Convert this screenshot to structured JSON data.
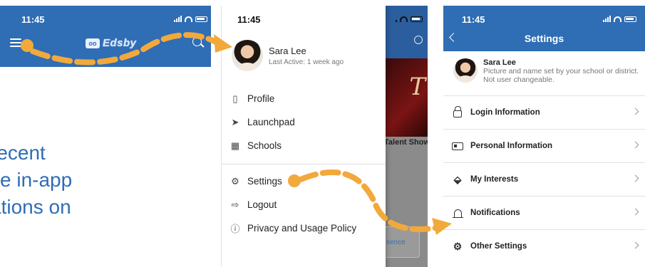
{
  "left_screen": {
    "time": "11:45",
    "logo_text": "Edsby",
    "caption_lines": [
      "recent",
      "ve in-app",
      "ations on"
    ]
  },
  "middle_screen": {
    "time": "11:45",
    "profile": {
      "name": "Sara Lee",
      "last_active": "Last Active: 1 week ago"
    },
    "menu_group_1": [
      {
        "icon": "profile-icon",
        "label": "Profile"
      },
      {
        "icon": "rocket-icon",
        "label": "Launchpad"
      },
      {
        "icon": "building-icon",
        "label": "Schools"
      }
    ],
    "menu_group_2": [
      {
        "icon": "gear-icon",
        "label": "Settings"
      },
      {
        "icon": "logout-icon",
        "label": "Logout"
      },
      {
        "icon": "info-icon",
        "label": "Privacy and Usage Policy"
      }
    ],
    "behind": {
      "event_title": "Talent Show",
      "button_fragment": "sence"
    }
  },
  "right_screen": {
    "time": "11:45",
    "title": "Settings",
    "profile": {
      "name": "Sara Lee",
      "note": "Picture and name set by your school or district. Not user changeable."
    },
    "rows": [
      {
        "icon": "lock-icon",
        "label": "Login Information"
      },
      {
        "icon": "id-card-icon",
        "label": "Personal Information"
      },
      {
        "icon": "tag-icon",
        "label": "My Interests"
      },
      {
        "icon": "bell-icon",
        "label": "Notifications"
      },
      {
        "icon": "gear-icon",
        "label": "Other Settings"
      }
    ]
  },
  "colors": {
    "brand_blue": "#2f6db5",
    "arrow_orange": "#f2a93b"
  }
}
